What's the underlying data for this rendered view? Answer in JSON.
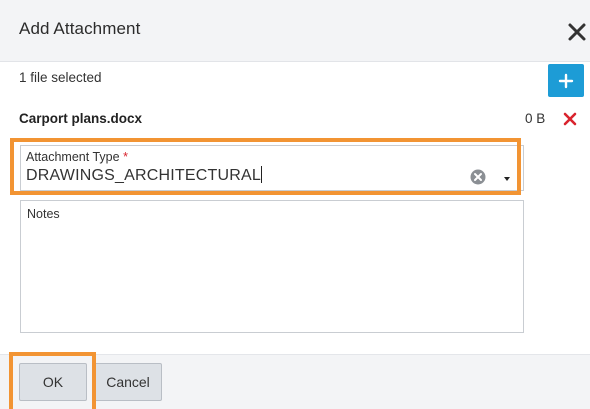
{
  "dialog": {
    "title": "Add Attachment",
    "close_icon": "close-icon"
  },
  "upload": {
    "file_count": "1 file selected",
    "add_icon": "plus-icon"
  },
  "file": {
    "name": "Carport plans.docx",
    "size": "0 B",
    "remove_icon": "remove-x-icon"
  },
  "attachment_type": {
    "label": "Attachment Type",
    "required_marker": "*",
    "value": "DRAWINGS_ARCHITECTURAL",
    "clear_icon": "clear-circle-icon",
    "dropdown_icon": "caret-down-icon"
  },
  "notes": {
    "label": "Notes",
    "value": ""
  },
  "footer": {
    "ok_label": "OK",
    "cancel_label": "Cancel"
  },
  "colors": {
    "accent": "#1d9cd6",
    "highlight": "#f29433",
    "required": "#d9232d",
    "remove": "#d9232d"
  }
}
